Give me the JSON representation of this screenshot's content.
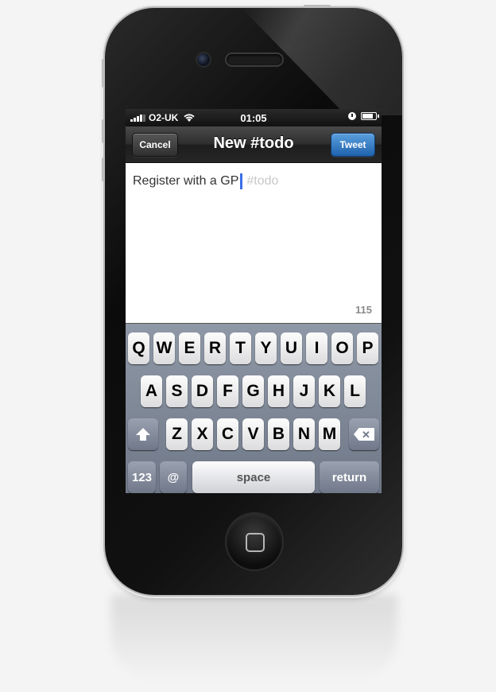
{
  "status_bar": {
    "carrier": "O2-UK",
    "time": "01:05",
    "signal_bars": 4,
    "battery_level": 0.7
  },
  "nav_bar": {
    "title": "New #todo",
    "cancel_label": "Cancel",
    "tweet_label": "Tweet"
  },
  "compose": {
    "text": "Register with a GP",
    "hashtag": "#todo",
    "char_count": "115"
  },
  "keyboard": {
    "row1": [
      "Q",
      "W",
      "E",
      "R",
      "T",
      "Y",
      "U",
      "I",
      "O",
      "P"
    ],
    "row2": [
      "A",
      "S",
      "D",
      "F",
      "G",
      "H",
      "J",
      "K",
      "L"
    ],
    "row3": [
      "Z",
      "X",
      "C",
      "V",
      "B",
      "N",
      "M"
    ],
    "numbers_label": "123",
    "at_label": "@",
    "space_label": "space",
    "return_label": "return"
  },
  "colors": {
    "tweet_button": "#2f78c4",
    "cursor": "#3b6ee8",
    "keyboard_bg": "#7d8696"
  },
  "icons": [
    "wifi-icon",
    "alarm-clock-icon",
    "battery-icon",
    "shift-icon",
    "backspace-icon",
    "home-button-icon"
  ]
}
